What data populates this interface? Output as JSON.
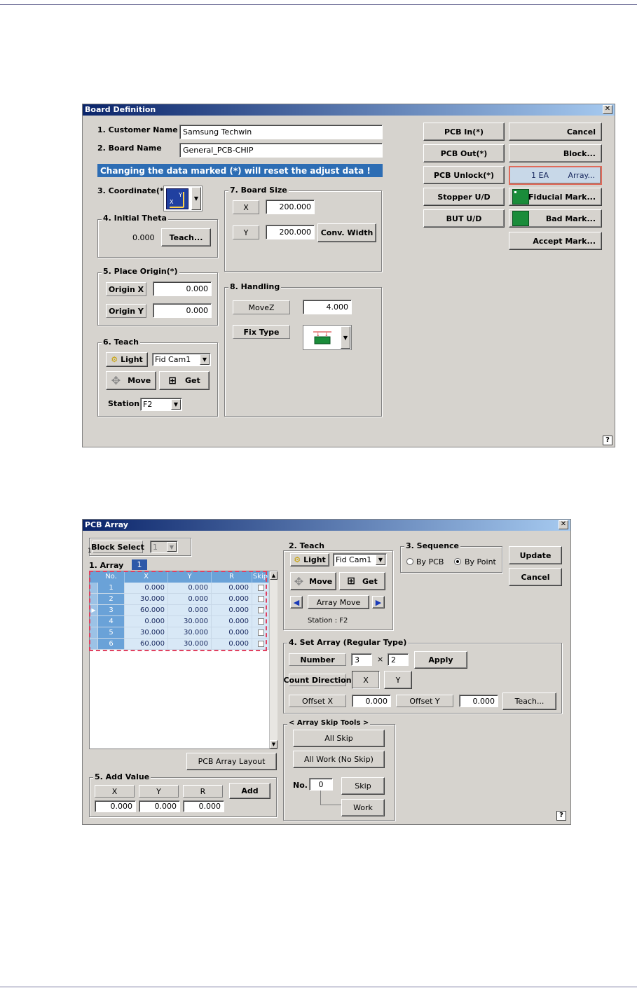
{
  "board": {
    "title": "Board Definition",
    "customer_label": "1. Customer Name",
    "customer_value": "Samsung Techwin",
    "board_label": "2. Board Name",
    "board_value": "General_PCB-CHIP",
    "warning": "Changing the data marked (*) will reset the adjust data !",
    "coord_label": "3. Coordinate(*)",
    "theta_label": "4. Initial Theta",
    "theta_value": "0.000",
    "theta_teach": "Teach...",
    "origin_label": "5. Place Origin(*)",
    "origin_x_label": "Origin X",
    "origin_x_value": "0.000",
    "origin_y_label": "Origin Y",
    "origin_y_value": "0.000",
    "teach_label": "6. Teach",
    "light": "Light",
    "cam": "Fid Cam1",
    "move": "Move",
    "get": "Get",
    "station_label": "Station",
    "station_value": "F2",
    "size_label": "7. Board Size",
    "size_x_label": "X",
    "size_x_value": "200.000",
    "size_y_label": "Y",
    "size_y_value": "200.000",
    "conv_width": "Conv. Width",
    "handling_label": "8. Handling",
    "movez_label": "MoveZ",
    "movez_value": "4.000",
    "fix_label": "Fix Type",
    "buttons": {
      "pcb_in": "PCB In(*)",
      "pcb_out": "PCB Out(*)",
      "pcb_unlock": "PCB Unlock(*)",
      "stopper": "Stopper U/D",
      "but": "BUT U/D",
      "cancel": "Cancel",
      "block": "Block...",
      "array_count": "1 EA",
      "array": "Array...",
      "fiducial": "Fiducial Mark...",
      "bad": "Bad Mark...",
      "accept": "Accept Mark..."
    },
    "help": "?"
  },
  "array": {
    "title": "PCB Array",
    "block_select": "Block Select",
    "block_value": "1",
    "array_label": "1. Array",
    "array_index": "1",
    "small_marker": "1",
    "columns": [
      "No.",
      "X",
      "Y",
      "R",
      "Skip"
    ],
    "rows": [
      {
        "no": "1",
        "x": "0.000",
        "y": "0.000",
        "r": "0.000"
      },
      {
        "no": "2",
        "x": "30.000",
        "y": "0.000",
        "r": "0.000"
      },
      {
        "no": "3",
        "x": "60.000",
        "y": "0.000",
        "r": "0.000"
      },
      {
        "no": "4",
        "x": "0.000",
        "y": "30.000",
        "r": "0.000"
      },
      {
        "no": "5",
        "x": "30.000",
        "y": "30.000",
        "r": "0.000"
      },
      {
        "no": "6",
        "x": "60.000",
        "y": "30.000",
        "r": "0.000"
      }
    ],
    "layout_btn": "PCB Array Layout",
    "add_label": "5. Add Value",
    "add_x": "X",
    "add_y": "Y",
    "add_r": "R",
    "add_btn": "Add",
    "add_x_value": "0.000",
    "add_y_value": "0.000",
    "add_r_value": "0.000",
    "teach_label": "2. Teach",
    "light": "Light",
    "cam": "Fid Cam1",
    "move": "Move",
    "get": "Get",
    "array_move": "Array Move",
    "station": "Station :  F2",
    "seq_label": "3. Sequence",
    "by_pcb": "By PCB",
    "by_point": "By Point",
    "update": "Update",
    "cancel": "Cancel",
    "set_label": "4. Set Array (Regular Type)",
    "number_label": "Number",
    "number_a": "3",
    "times": "×",
    "number_b": "2",
    "apply": "Apply",
    "count_dir": "Count Direction",
    "dir_x": "X",
    "dir_y": "Y",
    "offset_x_label": "Offset X",
    "offset_x_value": "0.000",
    "offset_y_label": "Offset Y",
    "offset_y_value": "0.000",
    "teach_btn": "Teach...",
    "skip_tools_label": "< Array Skip Tools >",
    "all_skip": "All Skip",
    "all_work": "All Work (No Skip)",
    "no_label": "No.",
    "no_value": "0",
    "skip": "Skip",
    "work": "Work",
    "help": "?"
  }
}
